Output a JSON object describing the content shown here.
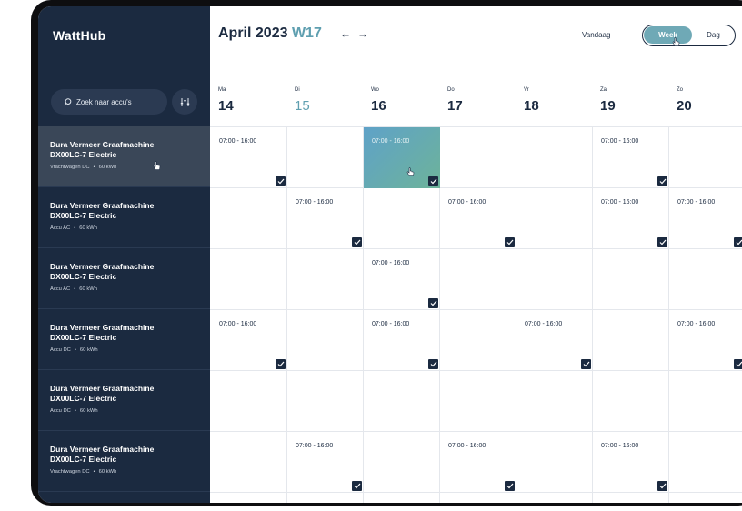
{
  "app": {
    "logo": "WattHub"
  },
  "header": {
    "month_year": "April 2023",
    "week_label": "W17",
    "prev_arrow": "←",
    "next_arrow": "→",
    "today_label": "Vandaag",
    "view_options": [
      "Week",
      "Dag"
    ],
    "active_view": "Week",
    "accent_color": "#5f9fb0"
  },
  "sidebar": {
    "search_placeholder": "Zoek naar accu's",
    "filter_icon": "sliders-icon",
    "vehicles": [
      {
        "name": "Dura Vermeer Graafmachine",
        "model": "DX00LC-7 Electric",
        "type": "Vrachtwagen DC",
        "capacity": "60 kWh",
        "active": true
      },
      {
        "name": "Dura Vermeer Graafmachine",
        "model": "DX00LC-7 Electric",
        "type": "Accu AC",
        "capacity": "60 kWh",
        "active": false
      },
      {
        "name": "Dura Vermeer Graafmachine",
        "model": "DX00LC-7 Electric",
        "type": "Accu AC",
        "capacity": "60 kWh",
        "active": false
      },
      {
        "name": "Dura Vermeer Graafmachine",
        "model": "DX00LC-7 Electric",
        "type": "Accu DC",
        "capacity": "60 kWh",
        "active": false
      },
      {
        "name": "Dura Vermeer Graafmachine",
        "model": "DX00LC-7 Electric",
        "type": "Accu DC",
        "capacity": "60 kWh",
        "active": false
      },
      {
        "name": "Dura Vermeer Graafmachine",
        "model": "DX00LC-7 Electric",
        "type": "Vrachtwagen DC",
        "capacity": "60 kWh",
        "active": false
      }
    ]
  },
  "days": [
    {
      "abbr": "Ma",
      "num": "14",
      "today": false
    },
    {
      "abbr": "Di",
      "num": "15",
      "today": true
    },
    {
      "abbr": "Wo",
      "num": "16",
      "today": false
    },
    {
      "abbr": "Do",
      "num": "17",
      "today": false
    },
    {
      "abbr": "Vr",
      "num": "18",
      "today": false
    },
    {
      "abbr": "Za",
      "num": "19",
      "today": false
    },
    {
      "abbr": "Zo",
      "num": "20",
      "today": false
    }
  ],
  "bookings": [
    {
      "row": 0,
      "day": 0,
      "time": "07:00 - 16:00",
      "highlight": false
    },
    {
      "row": 0,
      "day": 2,
      "time": "07:00 - 16:00",
      "highlight": true
    },
    {
      "row": 0,
      "day": 5,
      "time": "07:00 - 16:00",
      "highlight": false
    },
    {
      "row": 1,
      "day": 1,
      "time": "07:00 - 16:00",
      "highlight": false
    },
    {
      "row": 1,
      "day": 3,
      "time": "07:00 - 16:00",
      "highlight": false
    },
    {
      "row": 1,
      "day": 5,
      "time": "07:00 - 16:00",
      "highlight": false
    },
    {
      "row": 1,
      "day": 6,
      "time": "07:00 - 16:00",
      "highlight": false
    },
    {
      "row": 2,
      "day": 2,
      "time": "07:00 - 16:00",
      "highlight": false
    },
    {
      "row": 3,
      "day": 0,
      "time": "07:00 - 16:00",
      "highlight": false
    },
    {
      "row": 3,
      "day": 2,
      "time": "07:00 - 16:00",
      "highlight": false
    },
    {
      "row": 3,
      "day": 4,
      "time": "07:00 - 16:00",
      "highlight": false
    },
    {
      "row": 3,
      "day": 6,
      "time": "07:00 - 16:00",
      "highlight": false
    },
    {
      "row": 5,
      "day": 1,
      "time": "07:00 - 16:00",
      "highlight": false
    },
    {
      "row": 5,
      "day": 3,
      "time": "07:00 - 16:00",
      "highlight": false
    },
    {
      "row": 5,
      "day": 5,
      "time": "07:00 - 16:00",
      "highlight": false
    }
  ]
}
